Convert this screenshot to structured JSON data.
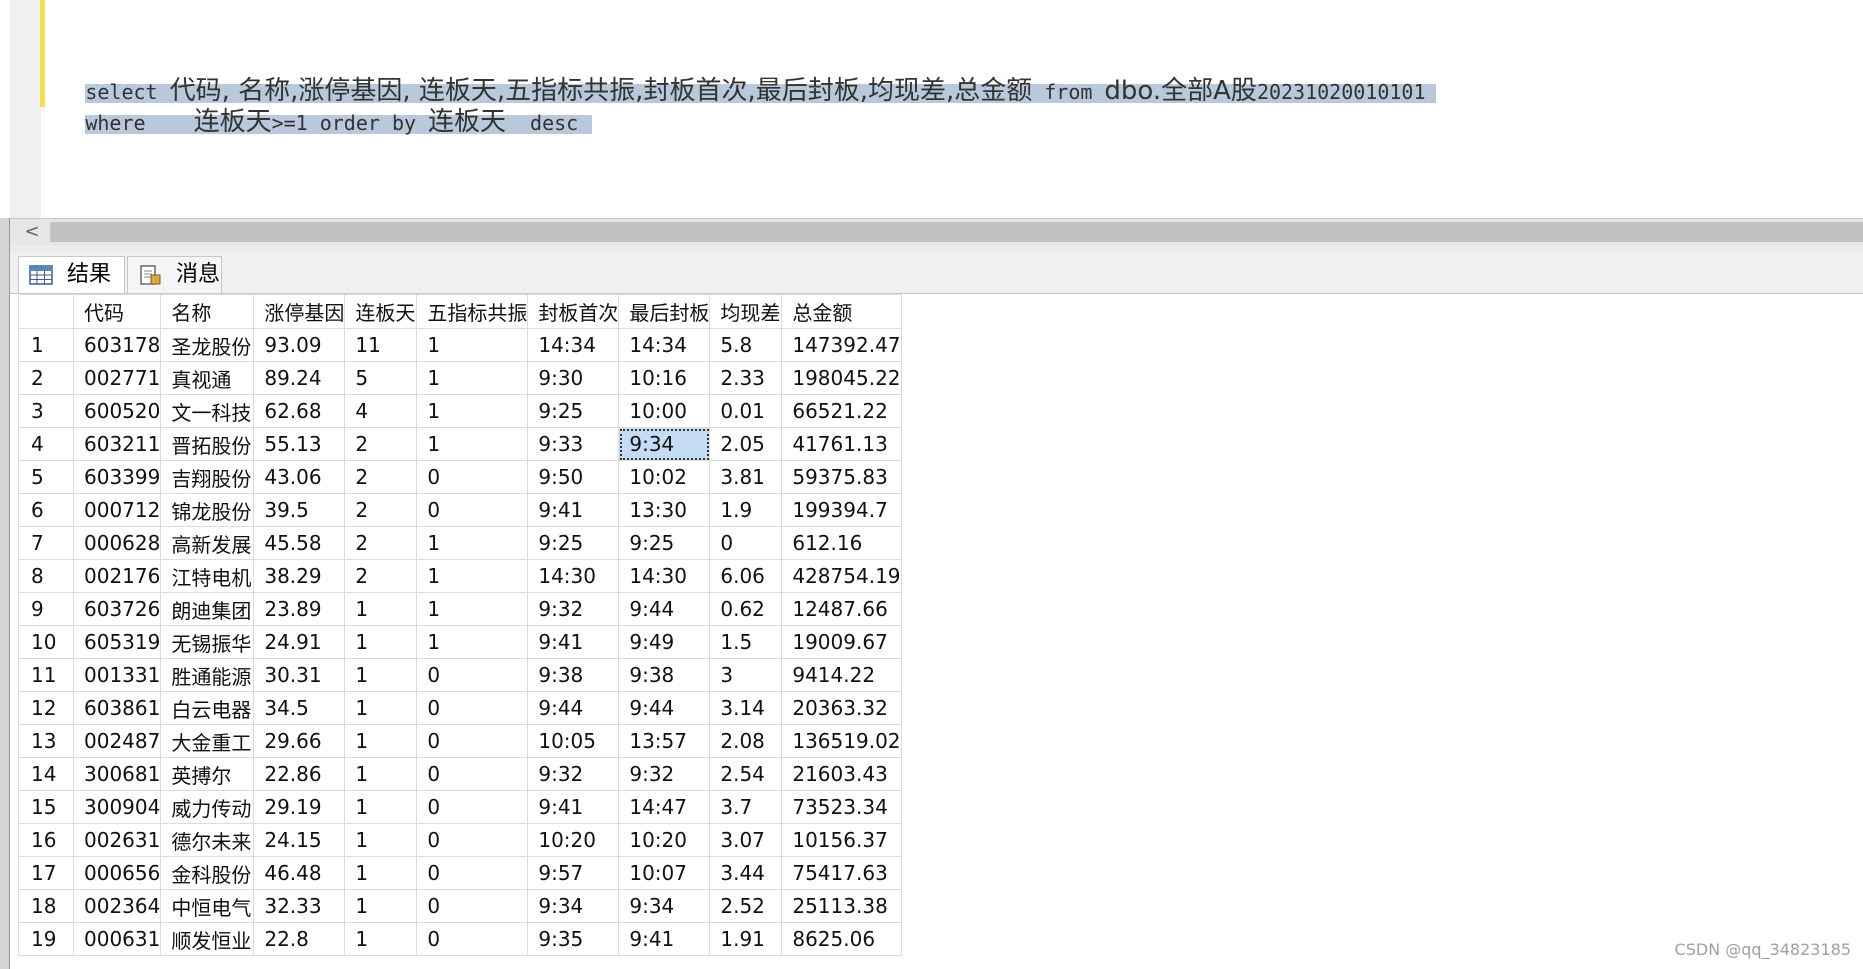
{
  "editor": {
    "line1": {
      "kw_select": "select",
      "columns": "代码, 名称,涨停基因, 连板天,五指标共振,封板首次,最后封板,均现差,总金额",
      "kw_from": "from",
      "table_prefix": "dbo.全部A股",
      "table_suffix": "20231020010101"
    },
    "line2": {
      "kw_where": "where",
      "cond_col": "连板天",
      "cond_op": ">=1",
      "kw_order_by": "order by",
      "order_col": "连板天",
      "kw_desc": "desc"
    }
  },
  "scroll": {
    "left_arrow": "<"
  },
  "tabs": {
    "results": "结果",
    "messages": "消息"
  },
  "grid": {
    "columns": [
      "",
      "代码",
      "名称",
      "涨停基因",
      "连板天",
      "五指标共振",
      "封板首次",
      "最后封板",
      "均现差",
      "总金额"
    ],
    "rows": [
      [
        "1",
        "603178",
        "圣龙股份",
        "93.09",
        "11",
        "1",
        "14:34",
        "14:34",
        "5.8",
        "147392.47"
      ],
      [
        "2",
        "002771",
        "真视通",
        "89.24",
        "5",
        "1",
        "9:30",
        "10:16",
        "2.33",
        "198045.22"
      ],
      [
        "3",
        "600520",
        "文一科技",
        "62.68",
        "4",
        "1",
        "9:25",
        "10:00",
        "0.01",
        "66521.22"
      ],
      [
        "4",
        "603211",
        "晋拓股份",
        "55.13",
        "2",
        "1",
        "9:33",
        "9:34",
        "2.05",
        "41761.13"
      ],
      [
        "5",
        "603399",
        "吉翔股份",
        "43.06",
        "2",
        "0",
        "9:50",
        "10:02",
        "3.81",
        "59375.83"
      ],
      [
        "6",
        "000712",
        "锦龙股份",
        "39.5",
        "2",
        "0",
        "9:41",
        "13:30",
        "1.9",
        "199394.7"
      ],
      [
        "7",
        "000628",
        "高新发展",
        "45.58",
        "2",
        "1",
        "9:25",
        "9:25",
        "0",
        "612.16"
      ],
      [
        "8",
        "002176",
        "江特电机",
        "38.29",
        "2",
        "1",
        "14:30",
        "14:30",
        "6.06",
        "428754.19"
      ],
      [
        "9",
        "603726",
        "朗迪集团",
        "23.89",
        "1",
        "1",
        "9:32",
        "9:44",
        "0.62",
        "12487.66"
      ],
      [
        "10",
        "605319",
        "无锡振华",
        "24.91",
        "1",
        "1",
        "9:41",
        "9:49",
        "1.5",
        "19009.67"
      ],
      [
        "11",
        "001331",
        "胜通能源",
        "30.31",
        "1",
        "0",
        "9:38",
        "9:38",
        "3",
        "9414.22"
      ],
      [
        "12",
        "603861",
        "白云电器",
        "34.5",
        "1",
        "0",
        "9:44",
        "9:44",
        "3.14",
        "20363.32"
      ],
      [
        "13",
        "002487",
        "大金重工",
        "29.66",
        "1",
        "0",
        "10:05",
        "13:57",
        "2.08",
        "136519.02"
      ],
      [
        "14",
        "300681",
        "英搏尔",
        "22.86",
        "1",
        "0",
        "9:32",
        "9:32",
        "2.54",
        "21603.43"
      ],
      [
        "15",
        "300904",
        "威力传动",
        "29.19",
        "1",
        "0",
        "9:41",
        "14:47",
        "3.7",
        "73523.34"
      ],
      [
        "16",
        "002631",
        "德尔未来",
        "24.15",
        "1",
        "0",
        "10:20",
        "10:20",
        "3.07",
        "10156.37"
      ],
      [
        "17",
        "000656",
        "金科股份",
        "46.48",
        "1",
        "0",
        "9:57",
        "10:07",
        "3.44",
        "75417.63"
      ],
      [
        "18",
        "002364",
        "中恒电气",
        "32.33",
        "1",
        "0",
        "9:34",
        "9:34",
        "2.52",
        "25113.38"
      ],
      [
        "19",
        "000631",
        "顺发恒业",
        "22.8",
        "1",
        "0",
        "9:35",
        "9:41",
        "1.91",
        "8625.06"
      ]
    ],
    "active_cell": {
      "row": 3,
      "col": 7
    }
  },
  "watermark": "CSDN @qq_34823185",
  "colors": {
    "selection": "#b7c9da",
    "active_cell": "#c4ddf4",
    "change_bar": "#f2e04a"
  }
}
